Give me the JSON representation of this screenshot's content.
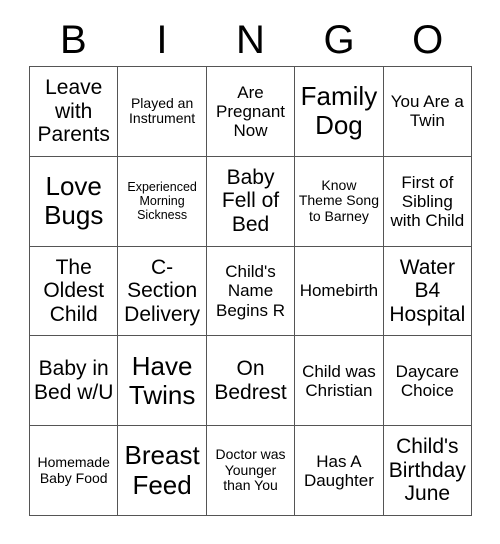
{
  "card": {
    "header_letters": [
      "B",
      "I",
      "N",
      "G",
      "O"
    ],
    "rows": [
      [
        {
          "text": "Leave with Parents",
          "size": "lg"
        },
        {
          "text": "Played an Instrument",
          "size": "sm"
        },
        {
          "text": "Are Pregnant Now",
          "size": "md"
        },
        {
          "text": "Family Dog",
          "size": "xl"
        },
        {
          "text": "You Are a Twin",
          "size": "md"
        }
      ],
      [
        {
          "text": "Love Bugs",
          "size": "xl"
        },
        {
          "text": "Experienced Morning Sickness",
          "size": "xs"
        },
        {
          "text": "Baby Fell of Bed",
          "size": "lg"
        },
        {
          "text": "Know Theme Song to Barney",
          "size": "sm"
        },
        {
          "text": "First of Sibling with Child",
          "size": "md"
        }
      ],
      [
        {
          "text": "The Oldest Child",
          "size": "lg"
        },
        {
          "text": "C-Section Delivery",
          "size": "lg"
        },
        {
          "text": "Child's Name Begins R",
          "size": "md"
        },
        {
          "text": "Homebirth",
          "size": "md"
        },
        {
          "text": "Water B4 Hospital",
          "size": "lg"
        }
      ],
      [
        {
          "text": "Baby in Bed w/U",
          "size": "lg"
        },
        {
          "text": "Have Twins",
          "size": "xl"
        },
        {
          "text": "On Bedrest",
          "size": "lg"
        },
        {
          "text": "Child was Christian",
          "size": "md"
        },
        {
          "text": "Daycare Choice",
          "size": "md"
        }
      ],
      [
        {
          "text": "Homemade Baby Food",
          "size": "sm"
        },
        {
          "text": "Breast Feed",
          "size": "xl"
        },
        {
          "text": "Doctor was Younger than You",
          "size": "sm"
        },
        {
          "text": "Has A Daughter",
          "size": "md"
        },
        {
          "text": "Child's Birthday June",
          "size": "lg"
        }
      ]
    ]
  },
  "colors": {
    "background": "#ffffff",
    "border": "#555555",
    "text": "#000000"
  }
}
